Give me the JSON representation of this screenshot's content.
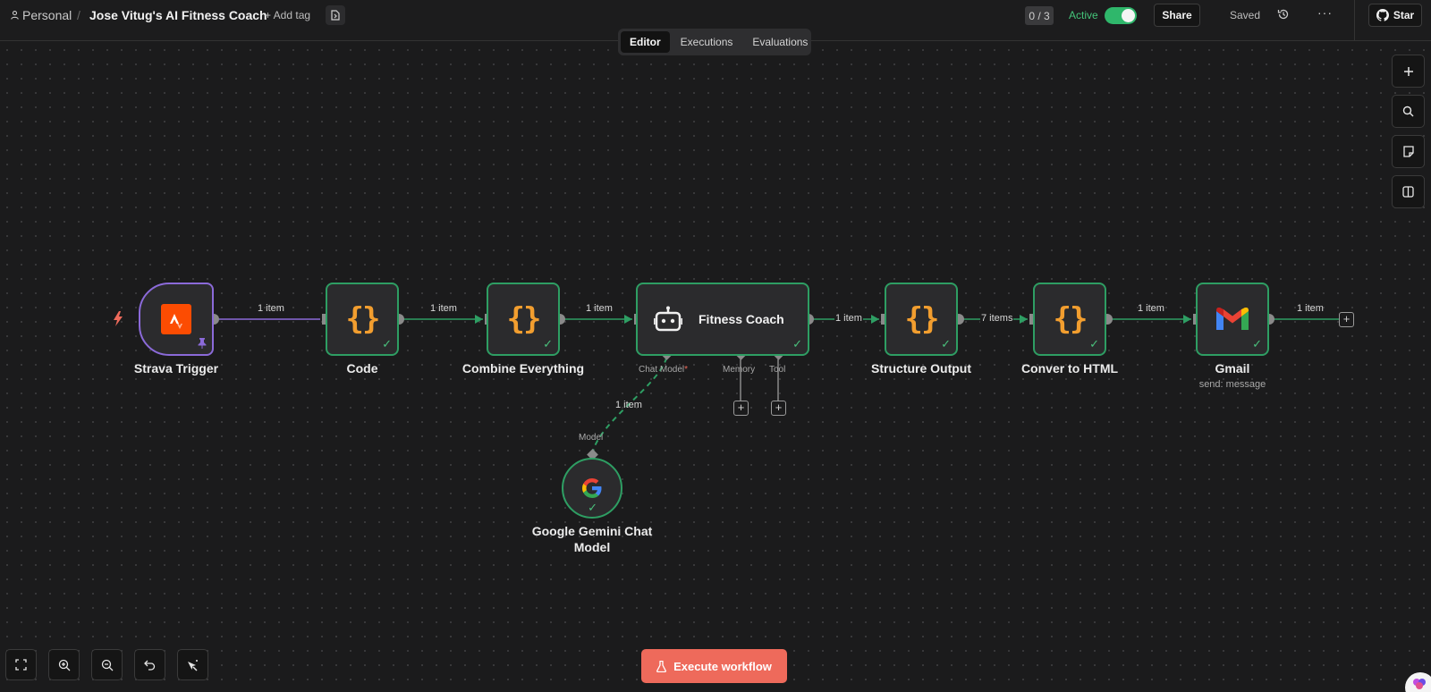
{
  "header": {
    "breadcrumb_user": "Personal",
    "breadcrumb_separator": "/",
    "workflow_name": "Jose Vitug's AI Fitness Coach",
    "add_tag_label": "+ Add tag",
    "counter": "0 / 3",
    "active_label": "Active",
    "active_state": true,
    "share_label": "Share",
    "saved_label": "Saved",
    "more_label": "···",
    "star_label": "Star"
  },
  "tabs": [
    {
      "label": "Editor",
      "active": true
    },
    {
      "label": "Executions",
      "active": false
    },
    {
      "label": "Evaluations",
      "active": false
    }
  ],
  "nodes": {
    "strava": {
      "label": "Strava Trigger",
      "icon": "strava-icon"
    },
    "code": {
      "label": "Code",
      "icon": "code-braces-icon"
    },
    "combine": {
      "label": "Combine Everything",
      "icon": "code-braces-icon"
    },
    "coach": {
      "label": "Fitness Coach",
      "icon": "robot-icon"
    },
    "structure": {
      "label": "Structure Output",
      "icon": "code-braces-icon"
    },
    "html": {
      "label": "Conver to HTML",
      "icon": "code-braces-icon"
    },
    "gmail": {
      "label": "Gmail",
      "sublabel": "send: message",
      "icon": "gmail-icon"
    },
    "gemini": {
      "label_line1": "Google Gemini Chat",
      "label_line2": "Model",
      "icon": "google-icon"
    }
  },
  "node_icon_glyph": "{}",
  "check_glyph": "✓",
  "edges": {
    "strava_code": "1 item",
    "code_combine": "1 item",
    "combine_coach": "1 item",
    "coach_structure": "1 item",
    "structure_html": "7 items",
    "html_gmail": "1 item",
    "gmail_out": "1 item",
    "gemini_coach": "1 item"
  },
  "ports": {
    "chat_model": "Chat Model",
    "chat_model_required": "*",
    "memory": "Memory",
    "tool": "Tool",
    "model": "Model"
  },
  "execute_label": "Execute workflow",
  "colors": {
    "success": "#2e9e63",
    "trigger": "#8b6ad9",
    "code_icon": "#f29e2f",
    "execute": "#ee6a5b",
    "strava": "#fc4c02"
  }
}
